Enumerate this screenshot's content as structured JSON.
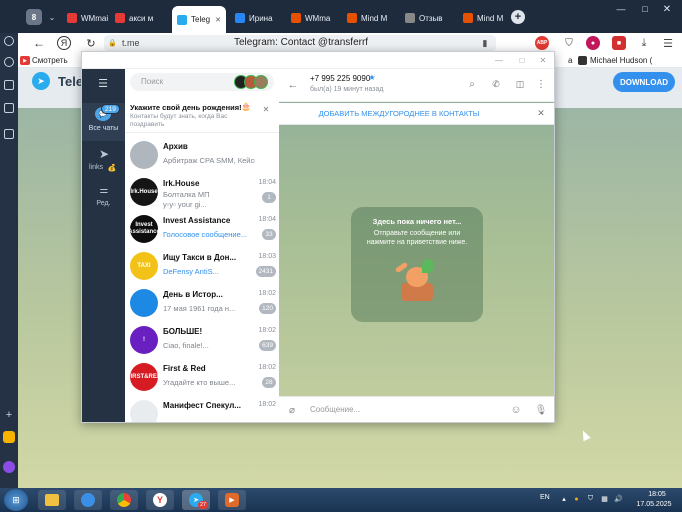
{
  "browser": {
    "profile_label": "8",
    "tabs": [
      {
        "label": "WMmail",
        "color": "#e53935"
      },
      {
        "label": "акси м",
        "color": "#e53935"
      },
      {
        "label": "Teleg",
        "color": "#2aabee",
        "active": true
      },
      {
        "label": "Ирина",
        "color": "#2787f5"
      },
      {
        "label": "WMma",
        "color": "#e65100"
      },
      {
        "label": "Mind M",
        "color": "#e65100"
      },
      {
        "label": "Отзыв",
        "color": "#888888"
      },
      {
        "label": "Mind M",
        "color": "#e65100"
      }
    ],
    "address": "t.me",
    "page_title": "Telegram: Contact @transferrf",
    "bookmarks": [
      {
        "label": "Смотреть"
      },
      {
        "label": "a"
      },
      {
        "label": "Michael Hudson ("
      }
    ]
  },
  "tgweb": {
    "logo_text": "Teleg",
    "download_label": "DOWNLOAD"
  },
  "popup": {
    "search_placeholder": "Поиск",
    "nav": {
      "all_chats_label": "Все чаты",
      "all_chats_badge": "219",
      "links_label": "links",
      "edit_label": "Ред."
    },
    "birthday": {
      "title": "Укажите свой день рождения!",
      "subtitle": "Контакты будут знать, когда Вас поздравить"
    },
    "chats": [
      {
        "name": "Архив",
        "time": "",
        "preview": "Арбитраж CPA SMM, Кейсы ...",
        "badge": "",
        "avatar_text": "",
        "avatar_color": "#b0b6bd"
      },
      {
        "name": "Irk.House",
        "time": "18:04",
        "preview": "Болталка  МП",
        "preview2": "у▫у▫ your gi...",
        "badge": "1",
        "avatar_text": "Irk.House",
        "avatar_color": "#151515"
      },
      {
        "name": "Invest Assistance",
        "time": "18:04",
        "preview": "Голосовое сообщение...",
        "badge": "33",
        "avatar_text": "Invest Assistance",
        "avatar_color": "#0d0d0d",
        "preview_blue": true
      },
      {
        "name": "Ищу Такси в Дон...",
        "time": "18:03",
        "preview": "DeFensy  AntiS...",
        "badge": "2431",
        "avatar_text": "TAXI",
        "avatar_color": "#f3c218",
        "preview_blue": true
      },
      {
        "name": "День в Истор...",
        "time": "18:02",
        "preview": "17 мая 1961 года н...",
        "badge": "120",
        "avatar_text": "",
        "avatar_color": "#1e88e5"
      },
      {
        "name": "БОЛЬШЕ!",
        "time": "18:02",
        "preview": "Ciao, finale!...",
        "badge": "639",
        "avatar_text": "!",
        "avatar_color": "#6a1fc0"
      },
      {
        "name": "First & Red",
        "time": "18:02",
        "preview": "Угадайте кто выше...",
        "badge": "28",
        "avatar_text": "FIRST&RED",
        "avatar_color": "#d61b22"
      },
      {
        "name": "Манифест Спекул...",
        "time": "18:02",
        "preview": "",
        "badge": "",
        "avatar_text": "",
        "avatar_color": "#e9ecef"
      }
    ],
    "contact": {
      "phone": "+7 995 225 9090",
      "status": "был(а) 19 минут назад"
    },
    "add_international_label": "ДОБАВИТЬ МЕЖДУГОРОДНЕЕ В КОНТАКТЫ",
    "empty": {
      "title": "Здесь пока ничего нет...",
      "subtitle": "Отправьте сообщение или нажмите на приветствие ниже."
    },
    "composer_placeholder": "Сообщение..."
  },
  "taskbar": {
    "lang": "EN",
    "time": "18:05",
    "date": "17.05.2025",
    "telegram_badge": "27"
  },
  "colors": {
    "telegram_blue": "#2aabee",
    "download_blue": "#3390ec",
    "dark_nav": "#253243"
  }
}
